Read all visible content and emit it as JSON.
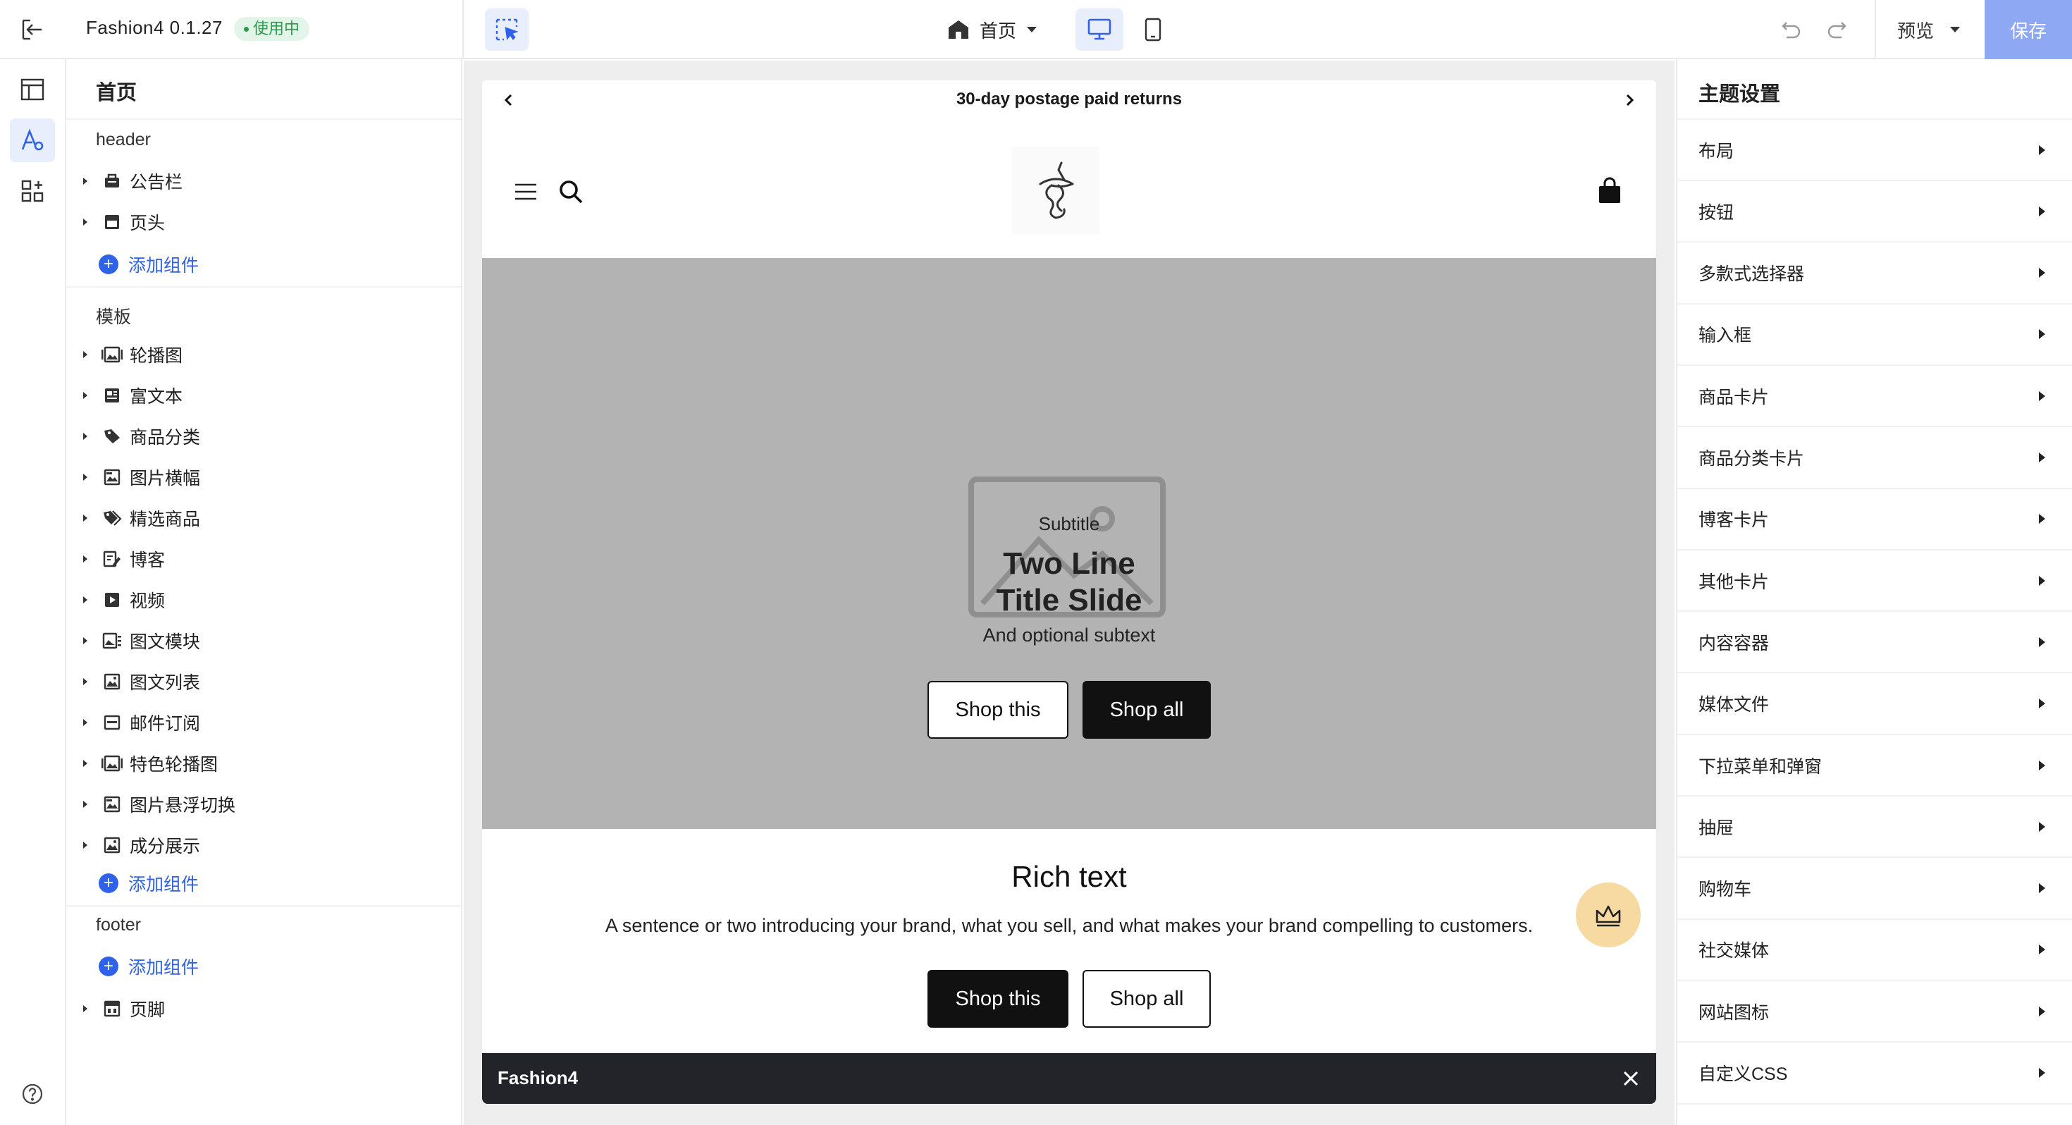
{
  "topbar": {
    "app_title": "Fashion4 0.1.27",
    "status": "使用中",
    "page_selector": "首页",
    "preview_label": "预览",
    "save_label": "保存"
  },
  "tree": {
    "title": "首页",
    "groups": {
      "header": "header",
      "template": "模板",
      "footer": "footer"
    },
    "header_items": [
      "公告栏",
      "页头"
    ],
    "template_items": [
      "轮播图",
      "富文本",
      "商品分类",
      "图片横幅",
      "精选商品",
      "博客",
      "视频",
      "图文模块",
      "图文列表",
      "邮件订阅",
      "特色轮播图",
      "图片悬浮切换",
      "成分展示"
    ],
    "footer_items": [
      "页脚"
    ],
    "add_label": "添加组件"
  },
  "preview": {
    "announcement": "30-day postage paid returns",
    "hero": {
      "subtitle": "Subtitle",
      "title_line1": "Two Line",
      "title_line2": "Title Slide",
      "text": "And optional subtext",
      "btn1": "Shop this",
      "btn2": "Shop all"
    },
    "rich": {
      "title": "Rich text",
      "text": "A sentence or two introducing your brand, what you sell, and what makes your brand compelling to customers.",
      "btn1": "Shop this",
      "btn2": "Shop all"
    },
    "bottom_bar_title": "Fashion4"
  },
  "settings": {
    "title": "主题设置",
    "items": [
      "布局",
      "按钮",
      "多款式选择器",
      "输入框",
      "商品卡片",
      "商品分类卡片",
      "博客卡片",
      "其他卡片",
      "内容容器",
      "媒体文件",
      "下拉菜单和弹窗",
      "抽屉",
      "购物车",
      "社交媒体",
      "网站图标",
      "自定义CSS"
    ]
  },
  "colors": {
    "accent": "#2f62e8",
    "save_bg": "#8ea8f3",
    "status_bg": "#e3f5e8",
    "status_fg": "#2e9a4c",
    "hero_bg": "#b3b3b3",
    "bar_bg": "#22242a"
  },
  "icons": {
    "exit": "exit-icon",
    "select": "select-tool-icon",
    "home": "home-icon",
    "desktop": "desktop-icon",
    "mobile": "mobile-icon",
    "undo": "undo-icon",
    "redo": "redo-icon"
  }
}
